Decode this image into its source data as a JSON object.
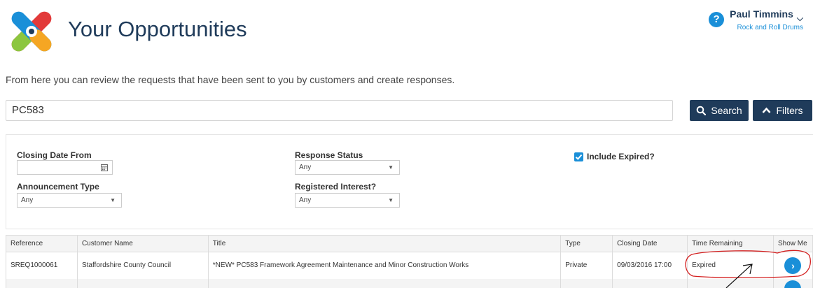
{
  "header": {
    "title": "Your Opportunities",
    "user_name": "Paul Timmins",
    "user_org": "Rock and Roll Drums"
  },
  "intro": "From here you can review the requests that have been sent to you by customers and create responses.",
  "search": {
    "value": "PC583",
    "search_label": "Search",
    "filters_label": "Filters"
  },
  "filters": {
    "closing_date_from_label": "Closing Date From",
    "closing_date_from_value": "",
    "announcement_type_label": "Announcement Type",
    "announcement_type_value": "Any",
    "response_status_label": "Response Status",
    "response_status_value": "Any",
    "registered_interest_label": "Registered Interest?",
    "registered_interest_value": "Any",
    "include_expired_label": "Include Expired?",
    "include_expired_checked": true
  },
  "table": {
    "columns": [
      "Reference",
      "Customer Name",
      "Title",
      "Type",
      "Closing Date",
      "Time Remaining",
      "Show Me"
    ],
    "rows": [
      {
        "reference": "SREQ1000061",
        "customer": "Staffordshire County Council",
        "title": "*NEW* PC583 Framework Agreement Maintenance and Minor Construction Works",
        "type": "Private",
        "closing_date": "09/03/2016 17:00",
        "time_remaining": "Expired"
      }
    ]
  },
  "colors": {
    "navy": "#1f3b5a",
    "accent_blue": "#1a8fd8",
    "annotation_red": "#d42020"
  }
}
